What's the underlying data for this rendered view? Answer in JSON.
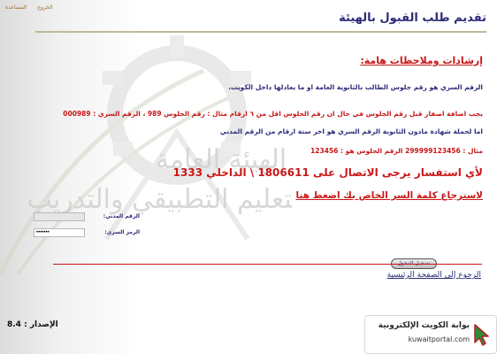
{
  "top_links": {
    "help": "المساعدة",
    "logout": "الخروج"
  },
  "page_title": "تقديم طلب القبول بالهيئة",
  "watermark": {
    "line1": "الهيئة العامة",
    "line2": "للتعليم التطبيقي والتدريب"
  },
  "instructions": {
    "heading": "إرشادات وملاحظات هامة:",
    "line1": "الرقم السري هو رقم جلوس الطالب بالثانوية العامة او ما يعادلها داخل الكويت.",
    "line2": "يجب اضافة اصفار قبل رقم الجلوس في حال ان رقم الجلوس اقل من ٦ ارقام مثال : رقم الجلوس 989 ، الرقم السري : 000989",
    "line3": "اما لحملة شهادة مادون الثانوية الرقم السري هو اخر ستة ارقام من الرقم المدني",
    "line4": "مثال : 299999123456 الرقم الجلوس هو : 123456",
    "line5": "لأي استفسار يرجى الاتصال على 1806611 \\ الداخلي 1333",
    "line6": "لاسترجاع كلمة السر الخاص بك اضغط هنا"
  },
  "login": {
    "civil_id_label": "الرقم المدني:",
    "civil_id_value": "",
    "password_label": "الرمز السري:",
    "password_value": "•••••••"
  },
  "submit_label": "تسجيل الدخول",
  "back_link": "الرجوع إلى الصفحة الرئيسية",
  "version": "الإصدار : 8.4",
  "portal": {
    "title": "بوابة الكويت الإلكترونية",
    "url": "kuwaitportal.com"
  },
  "colors": {
    "navy": "#2c2c7a",
    "red": "#c81818",
    "gold": "#8a6a1a"
  }
}
